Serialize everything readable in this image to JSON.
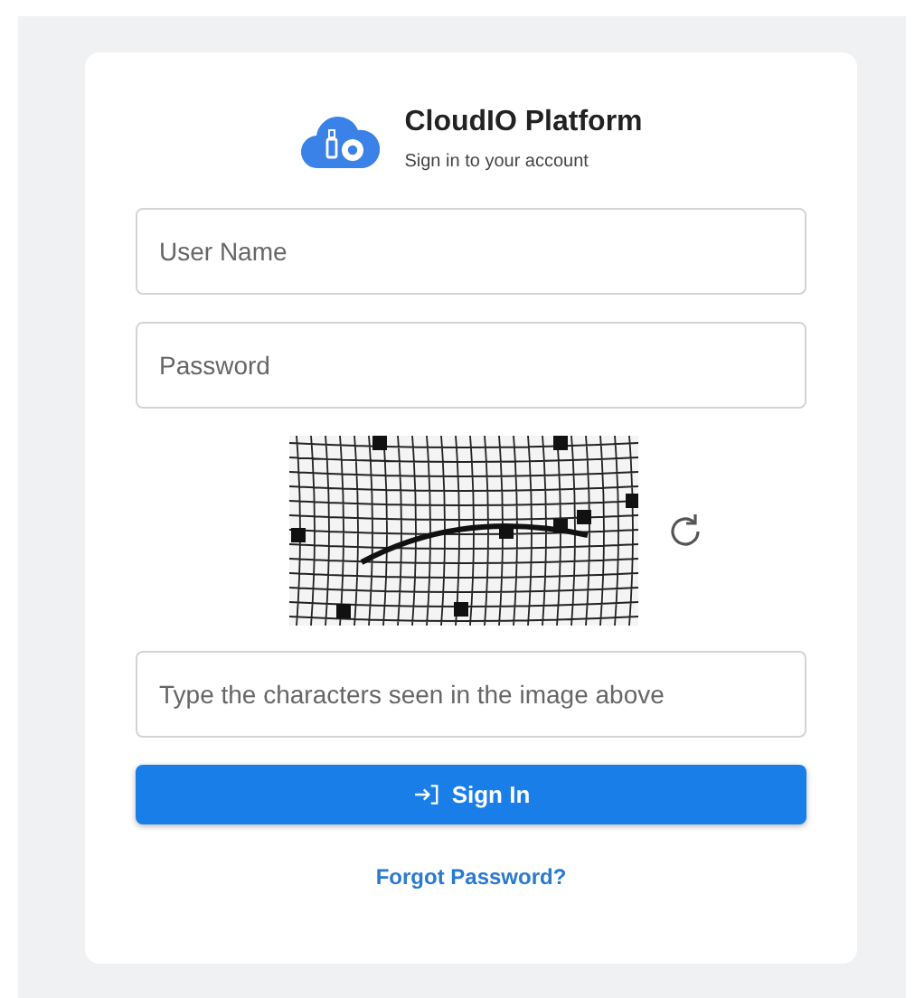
{
  "header": {
    "title": "CloudIO Platform",
    "subtitle": "Sign in to your account"
  },
  "fields": [
    {
      "placeholder": "User Name"
    },
    {
      "placeholder": "Password"
    }
  ],
  "captcha": {
    "kind": "picture",
    "answer_placeholder": "Type the characters seen in the image above"
  },
  "sign_in_button": {
    "label": "Sign In"
  },
  "forgot_link": "Forgot Password?"
}
